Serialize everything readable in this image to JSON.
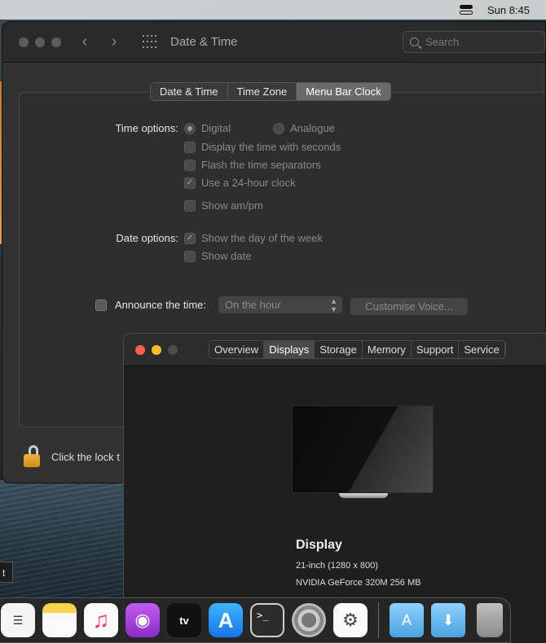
{
  "menubar": {
    "clock": "Sun 8:45"
  },
  "prefs": {
    "title": "Date & Time",
    "search_placeholder": "Search",
    "tabs": [
      "Date & Time",
      "Time Zone",
      "Menu Bar Clock"
    ],
    "active_tab": "Menu Bar Clock",
    "time_options_label": "Time options:",
    "date_options_label": "Date options:",
    "radio_digital": "Digital",
    "radio_analogue": "Analogue",
    "opt_seconds": "Display the time with seconds",
    "opt_flash": "Flash the time separators",
    "opt_24h": "Use a 24-hour clock",
    "opt_ampm": "Show am/pm",
    "opt_dayofweek": "Show the day of the week",
    "opt_showdate": "Show date",
    "announce_label": "Announce the time:",
    "announce_interval": "On the hour",
    "customise_voice": "Customise Voice...",
    "lock_text": "Click the lock t"
  },
  "about": {
    "tabs": [
      "Overview",
      "Displays",
      "Storage",
      "Memory",
      "Support",
      "Service"
    ],
    "active_tab": "Displays",
    "display_title": "Display",
    "display_size": "21-inch (1280 x 800)",
    "display_gpu": "NVIDIA GeForce 320M 256 MB"
  },
  "desktop_tag": "t",
  "dock": {
    "apps": [
      "reminders-icon",
      "notes-icon",
      "music-icon",
      "podcasts-icon",
      "tv-icon",
      "app-store-icon",
      "terminal-icon",
      "system-preferences-icon",
      "archive-utility-icon"
    ],
    "tv_label": "tv",
    "terminal_label": ">_"
  }
}
